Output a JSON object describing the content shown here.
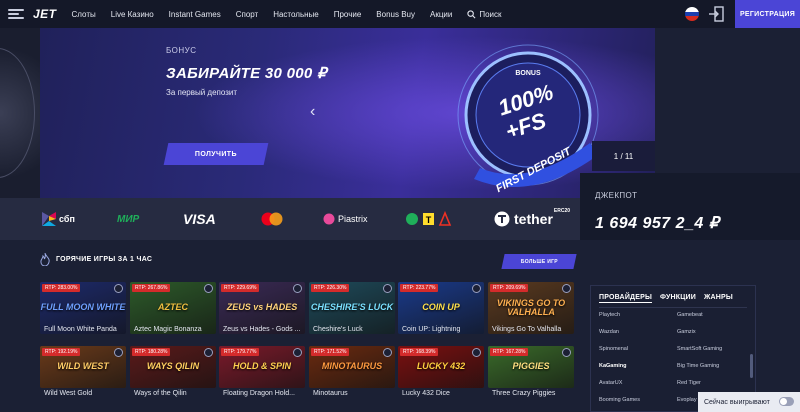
{
  "header": {
    "logo": "JET",
    "nav": [
      {
        "label": "Слоты"
      },
      {
        "label": "Live Казино"
      },
      {
        "label": "Instant Games"
      },
      {
        "label": "Спорт"
      },
      {
        "label": "Настольные"
      },
      {
        "label": "Прочие"
      },
      {
        "label": "Bonus Buy"
      },
      {
        "label": "Акции"
      },
      {
        "label": "Поиск",
        "icon": "search-icon"
      }
    ],
    "register_label": "РЕГИСТРАЦИЯ",
    "login_icon": "login-icon",
    "language_flag": "ru-flag"
  },
  "banner": {
    "small": "БОНУС",
    "title": "ЗАБИРАЙТЕ 30 000 ₽",
    "subtitle": "За первый депозит",
    "button_label": "ПОЛУЧИТЬ",
    "counter": "1 / 11",
    "badge": {
      "top": "BONUS",
      "main": "100%",
      "plus": "+FS",
      "ribbon": "FIRST DEPOSIT"
    }
  },
  "payments": [
    {
      "name": "сбп"
    },
    {
      "name": "МИР"
    },
    {
      "name": "VISA"
    },
    {
      "name": "mastercard-icon"
    },
    {
      "name": "Piastrix"
    },
    {
      "name": "Т"
    },
    {
      "name": "tether",
      "sup": "ERC20"
    }
  ],
  "jackpot": {
    "label": "ДЖЕКПОТ",
    "value": "1 694 957 2_4 ₽"
  },
  "hot_games": {
    "title": "ГОРЯЧИЕ ИГРЫ ЗА 1 ЧАС",
    "more_label": "БОЛЬШЕ ИГР",
    "games": [
      {
        "name": "Full Moon White Panda",
        "rtp": "RTP: 283.00%",
        "art": "FULL MOON WHITE",
        "bg": "#1d2a6b",
        "accent": "#6fa0ff"
      },
      {
        "name": "Aztec Magic Bonanza",
        "rtp": "RTP: 267.86%",
        "art": "AZTEC",
        "bg": "#2d5a2a",
        "accent": "#f0c040"
      },
      {
        "name": "Zeus vs Hades - Gods ...",
        "rtp": "RTP: 229.69%",
        "art": "ZEUS vs HADES",
        "bg": "#3a2a55",
        "accent": "#ffd27a"
      },
      {
        "name": "Cheshire's Luck",
        "rtp": "RTP: 226.30%",
        "art": "CHESHIRE'S LUCK",
        "bg": "#1e4a5a",
        "accent": "#7ae0ff"
      },
      {
        "name": "Coin UP: Lightning",
        "rtp": "RTP: 223.77%",
        "art": "COIN UP",
        "bg": "#1a3a8a",
        "accent": "#ffe04a"
      },
      {
        "name": "Vikings Go To Valhalla",
        "rtp": "RTP: 209.69%",
        "art": "VIKINGS GO TO VALHALLA",
        "bg": "#5a3a20",
        "accent": "#ffb050"
      },
      {
        "name": "Wild West Gold",
        "rtp": "RTP: 192.19%",
        "art": "WILD WEST",
        "bg": "#6a3a1a",
        "accent": "#ffcc66"
      },
      {
        "name": "Ways of the Qilin",
        "rtp": "RTP: 180.28%",
        "art": "WAYS QILIN",
        "bg": "#5a1a1a",
        "accent": "#ffd060"
      },
      {
        "name": "Floating Dragon Hold...",
        "rtp": "RTP: 179.77%",
        "art": "HOLD & SPIN",
        "bg": "#7a1a2a",
        "accent": "#ffd050"
      },
      {
        "name": "Minotaurus",
        "rtp": "RTP: 171.52%",
        "art": "MINOTAURUS",
        "bg": "#6a2a10",
        "accent": "#ff9a40"
      },
      {
        "name": "Lucky 432 Dice",
        "rtp": "RTP: 168.39%",
        "art": "LUCKY 432",
        "bg": "#7a1010",
        "accent": "#ffd040"
      },
      {
        "name": "Three Crazy Piggies",
        "rtp": "RTP: 167.28%",
        "art": "PIGGIES",
        "bg": "#3a6a2a",
        "accent": "#ffe080"
      }
    ]
  },
  "providers": {
    "tabs": [
      "ПРОВАЙДЕРЫ",
      "ФУНКЦИИ",
      "ЖАНРЫ"
    ],
    "left": [
      "Playtech",
      "Wazdan",
      "Spinomenal",
      "KaGaming",
      "AvatarUX",
      "Booming Games"
    ],
    "right": [
      "Gamebeat",
      "Gamzix",
      "SmartSoft Gaming",
      "Big Time Gaming",
      "Red Tiger",
      "Evoplay"
    ]
  },
  "now_winning": {
    "label": "Сейчас выигрывают"
  }
}
